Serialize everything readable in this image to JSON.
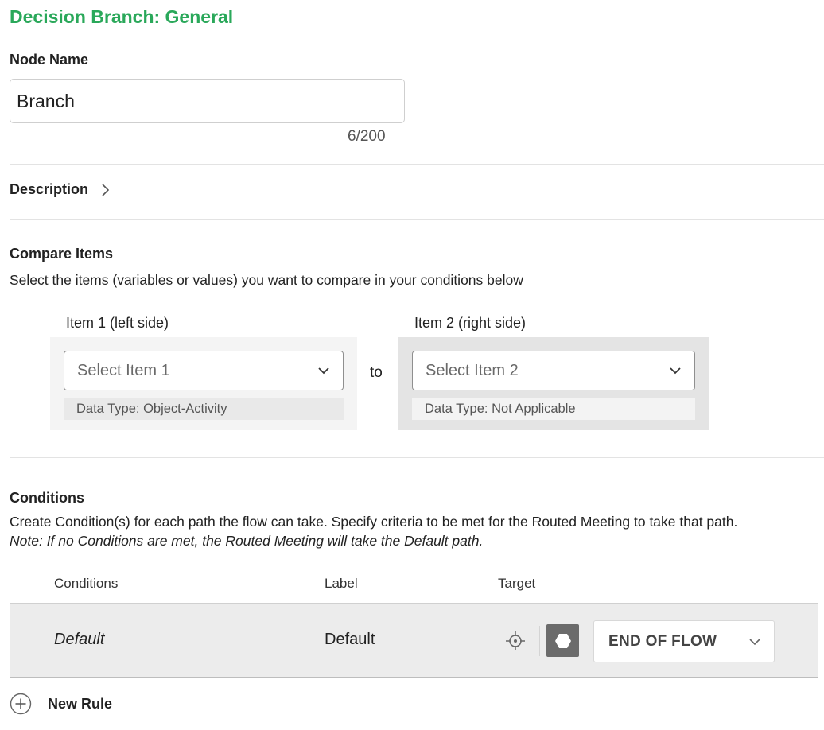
{
  "header": {
    "title": "Decision Branch: General"
  },
  "node_name": {
    "label": "Node Name",
    "value": "Branch",
    "counter": "6/200"
  },
  "description": {
    "label": "Description"
  },
  "compare": {
    "heading": "Compare Items",
    "subtitle": "Select the items (variables or values) you want to compare in your conditions below",
    "item1": {
      "label": "Item 1 (left side)",
      "placeholder": "Select Item 1",
      "data_type": "Data Type: Object-Activity"
    },
    "connector": "to",
    "item2": {
      "label": "Item 2 (right side)",
      "placeholder": "Select Item 2",
      "data_type": "Data Type: Not Applicable"
    }
  },
  "conditions": {
    "heading": "Conditions",
    "subtitle": "Create Condition(s) for each path the flow can take. Specify criteria to be met for the Routed Meeting to take that path.",
    "note": "Note: If no Conditions are met, the Routed Meeting will take the Default path.",
    "columns": {
      "conditions": "Conditions",
      "label": "Label",
      "target": "Target"
    },
    "rows": [
      {
        "condition": "Default",
        "label": "Default",
        "target": "END OF FLOW"
      }
    ],
    "new_rule": "New Rule"
  },
  "colors": {
    "accent": "#2aa85a"
  }
}
